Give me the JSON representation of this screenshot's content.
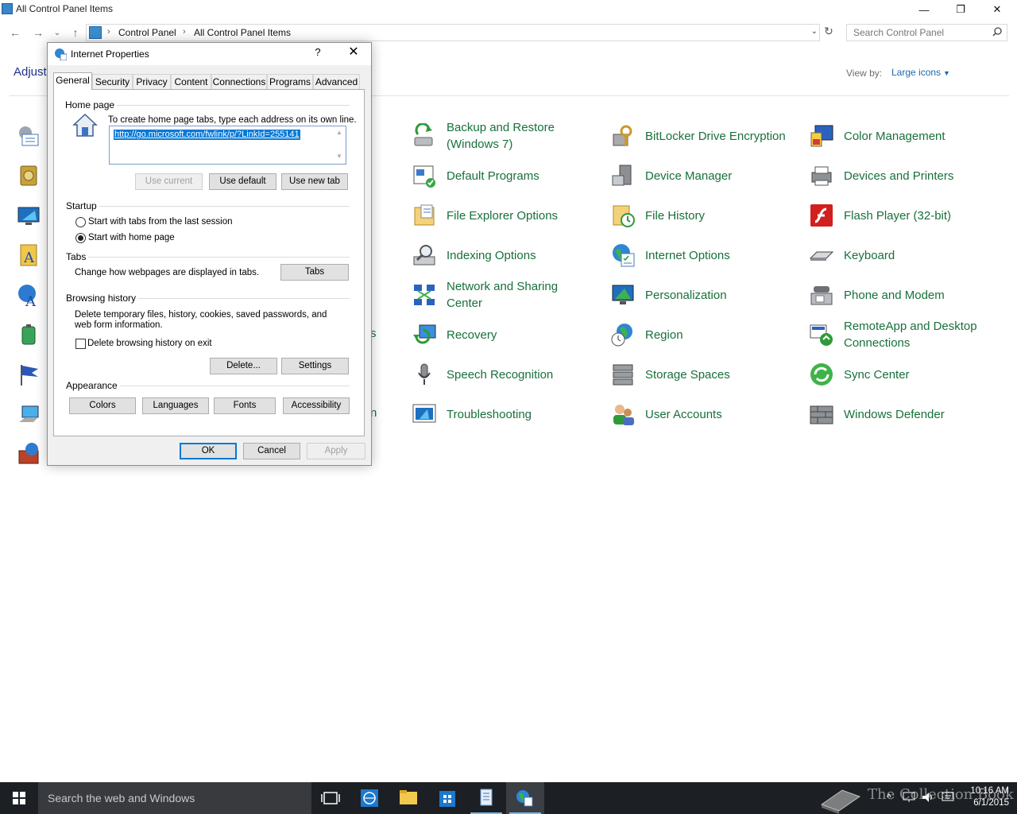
{
  "window": {
    "title": "All Control Panel Items",
    "minimize": "—",
    "restore": "❐",
    "close": "✕"
  },
  "address_bar": {
    "back": "←",
    "forward": "→",
    "recent": "⌄",
    "up": "↑",
    "crumbs": [
      "Control Panel",
      "All Control Panel Items"
    ],
    "crumb_sep": "›",
    "dropdown": "⌄",
    "refresh": "↻",
    "search_placeholder": "Search Control Panel"
  },
  "content": {
    "heading": "Adjust",
    "view_by_label": "View by:",
    "view_by_value": "Large icons",
    "partial_labels": [
      "s",
      "n"
    ]
  },
  "items": [
    {
      "label": "Backup and Restore (Windows 7)",
      "icon": "backup-restore-icon"
    },
    {
      "label": "BitLocker Drive Encryption",
      "icon": "bitlocker-icon"
    },
    {
      "label": "Color Management",
      "icon": "color-management-icon"
    },
    {
      "label": "Default Programs",
      "icon": "default-programs-icon"
    },
    {
      "label": "Device Manager",
      "icon": "device-manager-icon"
    },
    {
      "label": "Devices and Printers",
      "icon": "devices-printers-icon"
    },
    {
      "label": "File Explorer Options",
      "icon": "file-explorer-options-icon"
    },
    {
      "label": "File History",
      "icon": "file-history-icon"
    },
    {
      "label": "Flash Player (32-bit)",
      "icon": "flash-player-icon"
    },
    {
      "label": "Indexing Options",
      "icon": "indexing-options-icon"
    },
    {
      "label": "Internet Options",
      "icon": "internet-options-icon"
    },
    {
      "label": "Keyboard",
      "icon": "keyboard-icon"
    },
    {
      "label": "Network and Sharing Center",
      "icon": "network-sharing-icon"
    },
    {
      "label": "Personalization",
      "icon": "personalization-icon"
    },
    {
      "label": "Phone and Modem",
      "icon": "phone-modem-icon"
    },
    {
      "label": "Recovery",
      "icon": "recovery-icon"
    },
    {
      "label": "Region",
      "icon": "region-icon"
    },
    {
      "label": "RemoteApp and Desktop Connections",
      "icon": "remoteapp-icon"
    },
    {
      "label": "Speech Recognition",
      "icon": "speech-recognition-icon"
    },
    {
      "label": "Storage Spaces",
      "icon": "storage-spaces-icon"
    },
    {
      "label": "Sync Center",
      "icon": "sync-center-icon"
    },
    {
      "label": "Troubleshooting",
      "icon": "troubleshooting-icon"
    },
    {
      "label": "User Accounts",
      "icon": "user-accounts-icon"
    },
    {
      "label": "Windows Defender",
      "icon": "windows-defender-icon"
    }
  ],
  "dialog": {
    "title": "Internet Properties",
    "help": "?",
    "close": "✕",
    "tabs": [
      "General",
      "Security",
      "Privacy",
      "Content",
      "Connections",
      "Programs",
      "Advanced"
    ],
    "active_tab": "General",
    "home_page": {
      "group": "Home page",
      "instructions": "To create home page tabs, type each address on its own line.",
      "url": "http://go.microsoft.com/fwlink/p/?LinkId=255141",
      "use_current": "Use current",
      "use_default": "Use default",
      "use_new_tab": "Use new tab"
    },
    "startup": {
      "group": "Startup",
      "option_last_session": "Start with tabs from the last session",
      "option_home_page": "Start with home page",
      "selected": "Start with home page"
    },
    "tabs_group": {
      "group": "Tabs",
      "description": "Change how webpages are displayed in tabs.",
      "button": "Tabs"
    },
    "browsing_history": {
      "group": "Browsing history",
      "description": "Delete temporary files, history, cookies, saved passwords, and web form information.",
      "delete_on_exit": "Delete browsing history on exit",
      "delete_on_exit_checked": false,
      "delete_button": "Delete...",
      "settings_button": "Settings"
    },
    "appearance": {
      "group": "Appearance",
      "colors": "Colors",
      "languages": "Languages",
      "fonts": "Fonts",
      "accessibility": "Accessibility"
    },
    "ok": "OK",
    "cancel": "Cancel",
    "apply": "Apply"
  },
  "taskbar": {
    "search_placeholder": "Search the web and Windows",
    "apps": [
      "task-view-icon",
      "internet-explorer-icon",
      "file-explorer-icon",
      "store-icon",
      "control-panel-icon",
      "internet-properties-icon"
    ],
    "time": "10:16 AM",
    "date": "6/1/2015",
    "watermark": "The Collection Book"
  },
  "colors": {
    "link_green": "#18703a",
    "link_blue": "#1e69b2",
    "taskbar": "#1c1f23",
    "selection": "#0078d7"
  }
}
